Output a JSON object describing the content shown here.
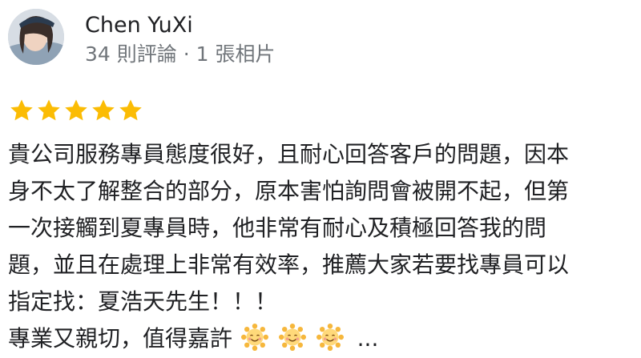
{
  "reviewer": {
    "name": "Chen YuXi",
    "meta": "34 則評論 · 1 張相片"
  },
  "review": {
    "rating": 5,
    "lines": [
      "貴公司服務專員態度很好，且耐心回答客戶的問題，因本",
      "身不太了解整合的部分，原本害怕詢問會被開不起，但第",
      "一次接觸到夏專員時，他非常有耐心及積極回答我的問",
      "題，並且在處理上非常有效率，推薦大家若要找專員可以",
      "指定找：夏浩天先生！！！",
      "專業又親切，值得嘉許"
    ],
    "ellipsis": "...",
    "icons": [
      "star-icon",
      "smiling-sun-emoji"
    ],
    "colors": {
      "star": "#fbbc04",
      "meta_text": "#70757a",
      "body_text": "#202124"
    }
  }
}
